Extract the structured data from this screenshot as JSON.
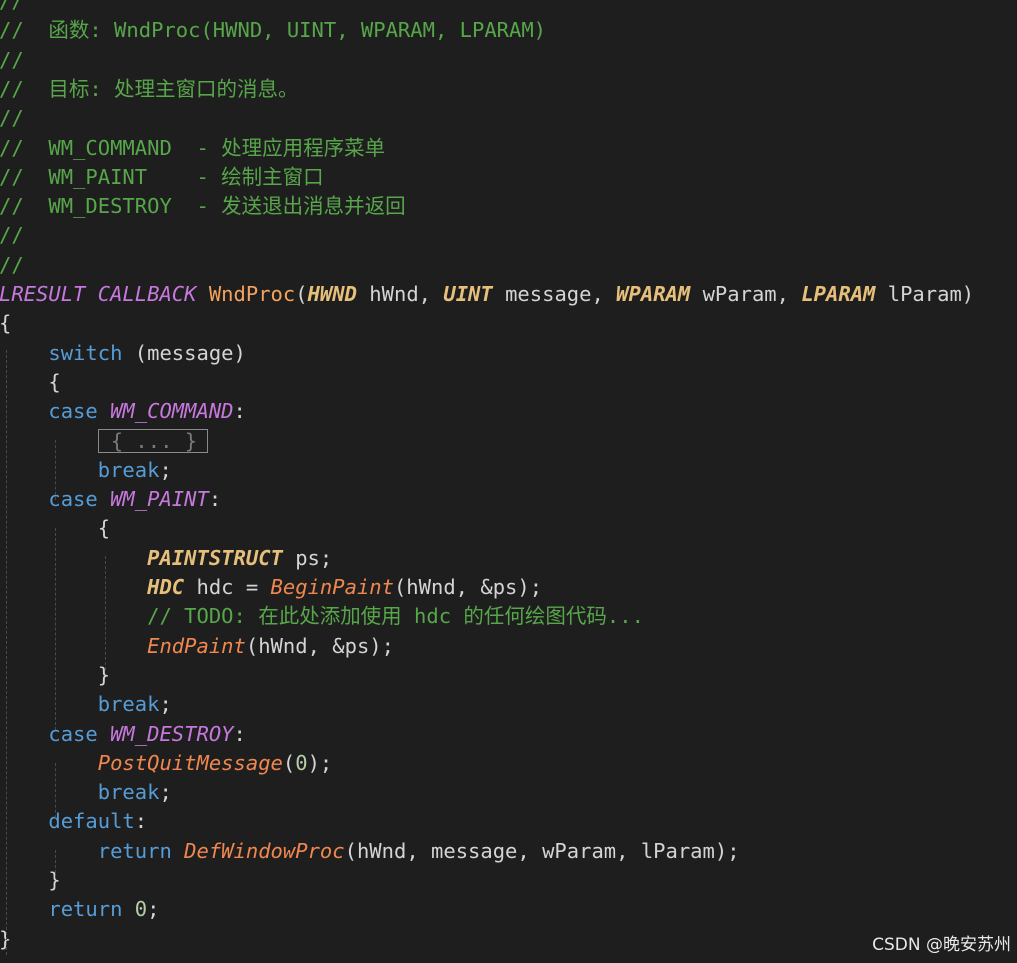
{
  "editor": {
    "lines": [
      [
        {
          "t": "//",
          "c": "cmt"
        }
      ],
      [
        {
          "t": "//  函数: WndProc(HWND, UINT, WPARAM, LPARAM)",
          "c": "cmt"
        }
      ],
      [
        {
          "t": "//",
          "c": "cmt"
        }
      ],
      [
        {
          "t": "//  目标: 处理主窗口的消息。",
          "c": "cmt"
        }
      ],
      [
        {
          "t": "//",
          "c": "cmt"
        }
      ],
      [
        {
          "t": "//  WM_COMMAND  - 处理应用程序菜单",
          "c": "cmt"
        }
      ],
      [
        {
          "t": "//  WM_PAINT    - 绘制主窗口",
          "c": "cmt"
        }
      ],
      [
        {
          "t": "//  WM_DESTROY  - 发送退出消息并返回",
          "c": "cmt"
        }
      ],
      [
        {
          "t": "//",
          "c": "cmt"
        }
      ],
      [
        {
          "t": "//",
          "c": "cmt"
        }
      ],
      [
        {
          "t": "LRESULT",
          "c": "mac"
        },
        {
          "t": " ",
          "c": "txt"
        },
        {
          "t": "CALLBACK",
          "c": "mac"
        },
        {
          "t": " ",
          "c": "txt"
        },
        {
          "t": "WndProc",
          "c": "def"
        },
        {
          "t": "(",
          "c": "txt"
        },
        {
          "t": "HWND",
          "c": "typ"
        },
        {
          "t": " hWnd, ",
          "c": "txt"
        },
        {
          "t": "UINT",
          "c": "typ"
        },
        {
          "t": " message, ",
          "c": "txt"
        },
        {
          "t": "WPARAM",
          "c": "typ"
        },
        {
          "t": " wParam, ",
          "c": "txt"
        },
        {
          "t": "LPARAM",
          "c": "typ"
        },
        {
          "t": " lParam)",
          "c": "txt"
        }
      ],
      [
        {
          "t": "{",
          "c": "txt"
        }
      ],
      [
        {
          "t": "    ",
          "c": "txt"
        },
        {
          "t": "switch",
          "c": "kw"
        },
        {
          "t": " (message)",
          "c": "txt"
        }
      ],
      [
        {
          "t": "    {",
          "c": "txt"
        }
      ],
      [
        {
          "t": "    ",
          "c": "txt"
        },
        {
          "t": "case",
          "c": "kw"
        },
        {
          "t": " ",
          "c": "txt"
        },
        {
          "t": "WM_COMMAND",
          "c": "mac"
        },
        {
          "t": ":",
          "c": "txt"
        }
      ],
      [
        {
          "t": "        ",
          "c": "txt"
        },
        {
          "t": "{ ... }",
          "c": "collapsed"
        }
      ],
      [
        {
          "t": "        ",
          "c": "txt"
        },
        {
          "t": "break",
          "c": "kw"
        },
        {
          "t": ";",
          "c": "txt"
        }
      ],
      [
        {
          "t": "    ",
          "c": "txt"
        },
        {
          "t": "case",
          "c": "kw"
        },
        {
          "t": " ",
          "c": "txt"
        },
        {
          "t": "WM_PAINT",
          "c": "mac"
        },
        {
          "t": ":",
          "c": "txt"
        }
      ],
      [
        {
          "t": "        {",
          "c": "txt"
        }
      ],
      [
        {
          "t": "            ",
          "c": "txt"
        },
        {
          "t": "PAINTSTRUCT",
          "c": "typ"
        },
        {
          "t": " ps;",
          "c": "txt"
        }
      ],
      [
        {
          "t": "            ",
          "c": "txt"
        },
        {
          "t": "HDC",
          "c": "typ"
        },
        {
          "t": " hdc = ",
          "c": "txt"
        },
        {
          "t": "BeginPaint",
          "c": "fn"
        },
        {
          "t": "(hWnd, &ps);",
          "c": "txt"
        }
      ],
      [
        {
          "t": "            ",
          "c": "txt"
        },
        {
          "t": "// TODO: 在此处添加使用 hdc 的任何绘图代码...",
          "c": "cmt"
        }
      ],
      [
        {
          "t": "            ",
          "c": "txt"
        },
        {
          "t": "EndPaint",
          "c": "fn"
        },
        {
          "t": "(hWnd, &ps);",
          "c": "txt"
        }
      ],
      [
        {
          "t": "        }",
          "c": "txt"
        }
      ],
      [
        {
          "t": "        ",
          "c": "txt"
        },
        {
          "t": "break",
          "c": "kw"
        },
        {
          "t": ";",
          "c": "txt"
        }
      ],
      [
        {
          "t": "    ",
          "c": "txt"
        },
        {
          "t": "case",
          "c": "kw"
        },
        {
          "t": " ",
          "c": "txt"
        },
        {
          "t": "WM_DESTROY",
          "c": "mac"
        },
        {
          "t": ":",
          "c": "txt"
        }
      ],
      [
        {
          "t": "        ",
          "c": "txt"
        },
        {
          "t": "PostQuitMessage",
          "c": "fn"
        },
        {
          "t": "(",
          "c": "txt"
        },
        {
          "t": "0",
          "c": "num"
        },
        {
          "t": ");",
          "c": "txt"
        }
      ],
      [
        {
          "t": "        ",
          "c": "txt"
        },
        {
          "t": "break",
          "c": "kw"
        },
        {
          "t": ";",
          "c": "txt"
        }
      ],
      [
        {
          "t": "    ",
          "c": "txt"
        },
        {
          "t": "default",
          "c": "kw"
        },
        {
          "t": ":",
          "c": "txt"
        }
      ],
      [
        {
          "t": "        ",
          "c": "txt"
        },
        {
          "t": "return",
          "c": "kw"
        },
        {
          "t": " ",
          "c": "txt"
        },
        {
          "t": "DefWindowProc",
          "c": "fn"
        },
        {
          "t": "(hWnd, message, wParam, lParam);",
          "c": "txt"
        }
      ],
      [
        {
          "t": "    }",
          "c": "txt"
        }
      ],
      [
        {
          "t": "    ",
          "c": "txt"
        },
        {
          "t": "return",
          "c": "kw"
        },
        {
          "t": " ",
          "c": "txt"
        },
        {
          "t": "0",
          "c": "num"
        },
        {
          "t": ";",
          "c": "txt"
        }
      ],
      [
        {
          "t": "}",
          "c": "txt"
        }
      ]
    ],
    "colors": {
      "background": "#1e1e1e",
      "comment": "#57a64a",
      "keyword": "#569cd6",
      "type": "#e6c07b",
      "macro": "#c678dd",
      "function": "#f0874f",
      "text": "#d4d4d4"
    }
  },
  "watermark": {
    "text": "CSDN @晚安苏州"
  }
}
